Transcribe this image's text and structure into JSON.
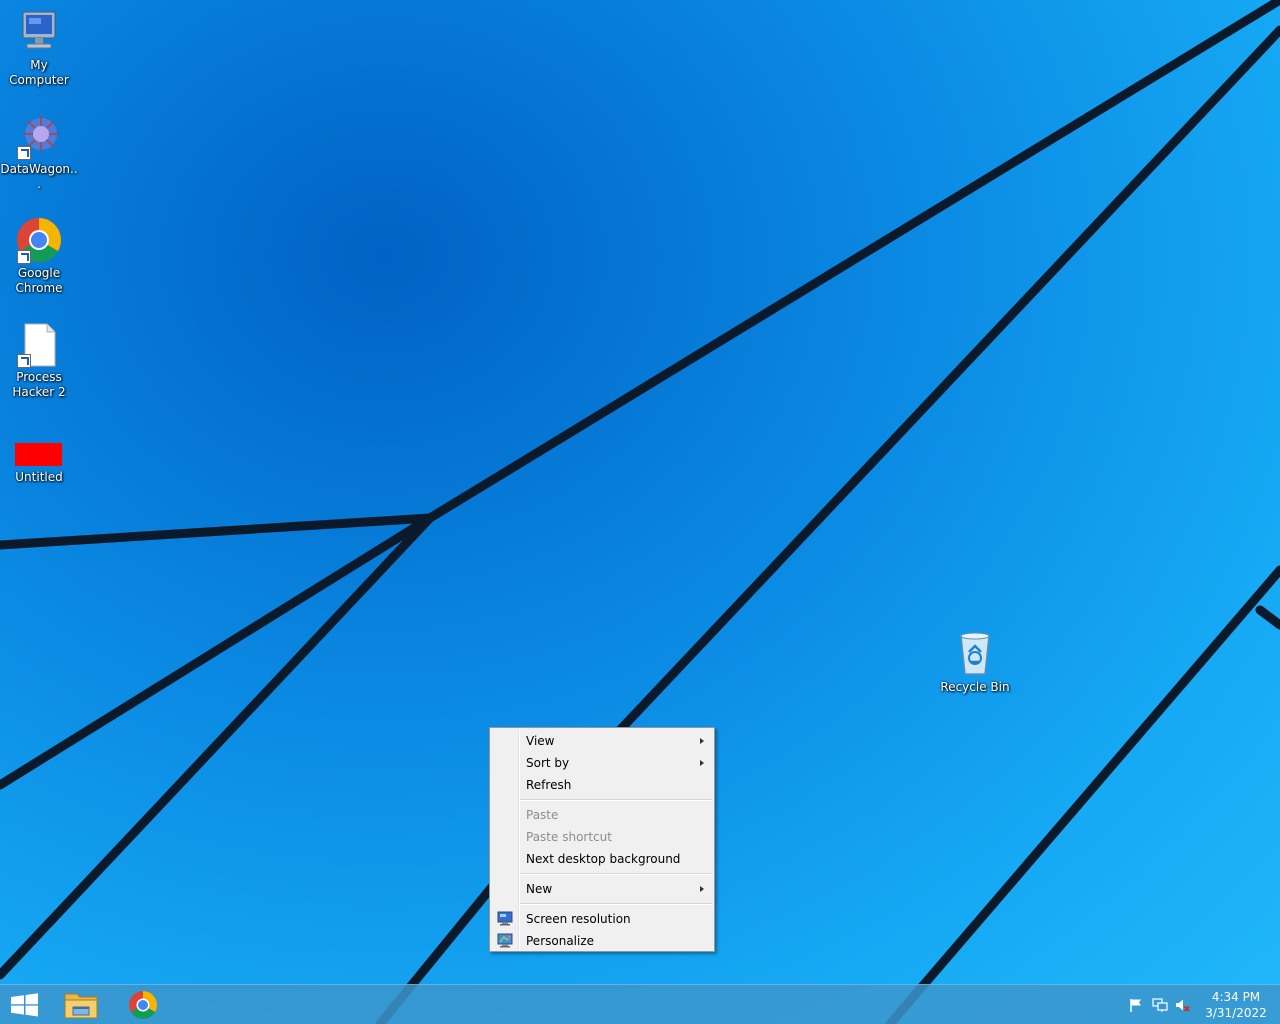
{
  "desktop_icons": [
    {
      "label": "My Computer",
      "icon": "computer-icon"
    },
    {
      "label": "DataWagon...",
      "icon": "datawagon-icon"
    },
    {
      "label": "Google Chrome",
      "icon": "chrome-icon"
    },
    {
      "label": "Process Hacker 2",
      "icon": "file-icon"
    },
    {
      "label": "Untitled",
      "icon": "red-rectangle-icon"
    },
    {
      "label": "Recycle Bin",
      "icon": "recycle-bin-icon"
    }
  ],
  "context_menu": {
    "items": [
      {
        "label": "View",
        "submenu": true,
        "enabled": true
      },
      {
        "label": "Sort by",
        "submenu": true,
        "enabled": true
      },
      {
        "label": "Refresh",
        "enabled": true
      },
      {
        "label": "Paste",
        "enabled": false
      },
      {
        "label": "Paste shortcut",
        "enabled": false
      },
      {
        "label": "Next desktop background",
        "enabled": true
      },
      {
        "label": "New",
        "submenu": true,
        "enabled": true
      },
      {
        "label": "Screen resolution",
        "enabled": true,
        "icon": "screen-resolution-icon"
      },
      {
        "label": "Personalize",
        "enabled": true,
        "icon": "personalize-icon"
      }
    ]
  },
  "taskbar": {
    "start_icon": "windows-logo-icon",
    "pinned": [
      "file-explorer-icon",
      "chrome-icon"
    ],
    "tray_icons": [
      "action-center-flag-icon",
      "network-icon",
      "speaker-muted-icon"
    ],
    "clock": {
      "time": "4:34 PM",
      "date": "3/31/2022"
    }
  },
  "colors": {
    "wallpaper_dark": "#0062c4",
    "wallpaper_light": "#22b8fa",
    "taskbar": "#3c96cd",
    "menu_bg": "#f0f0f0"
  }
}
